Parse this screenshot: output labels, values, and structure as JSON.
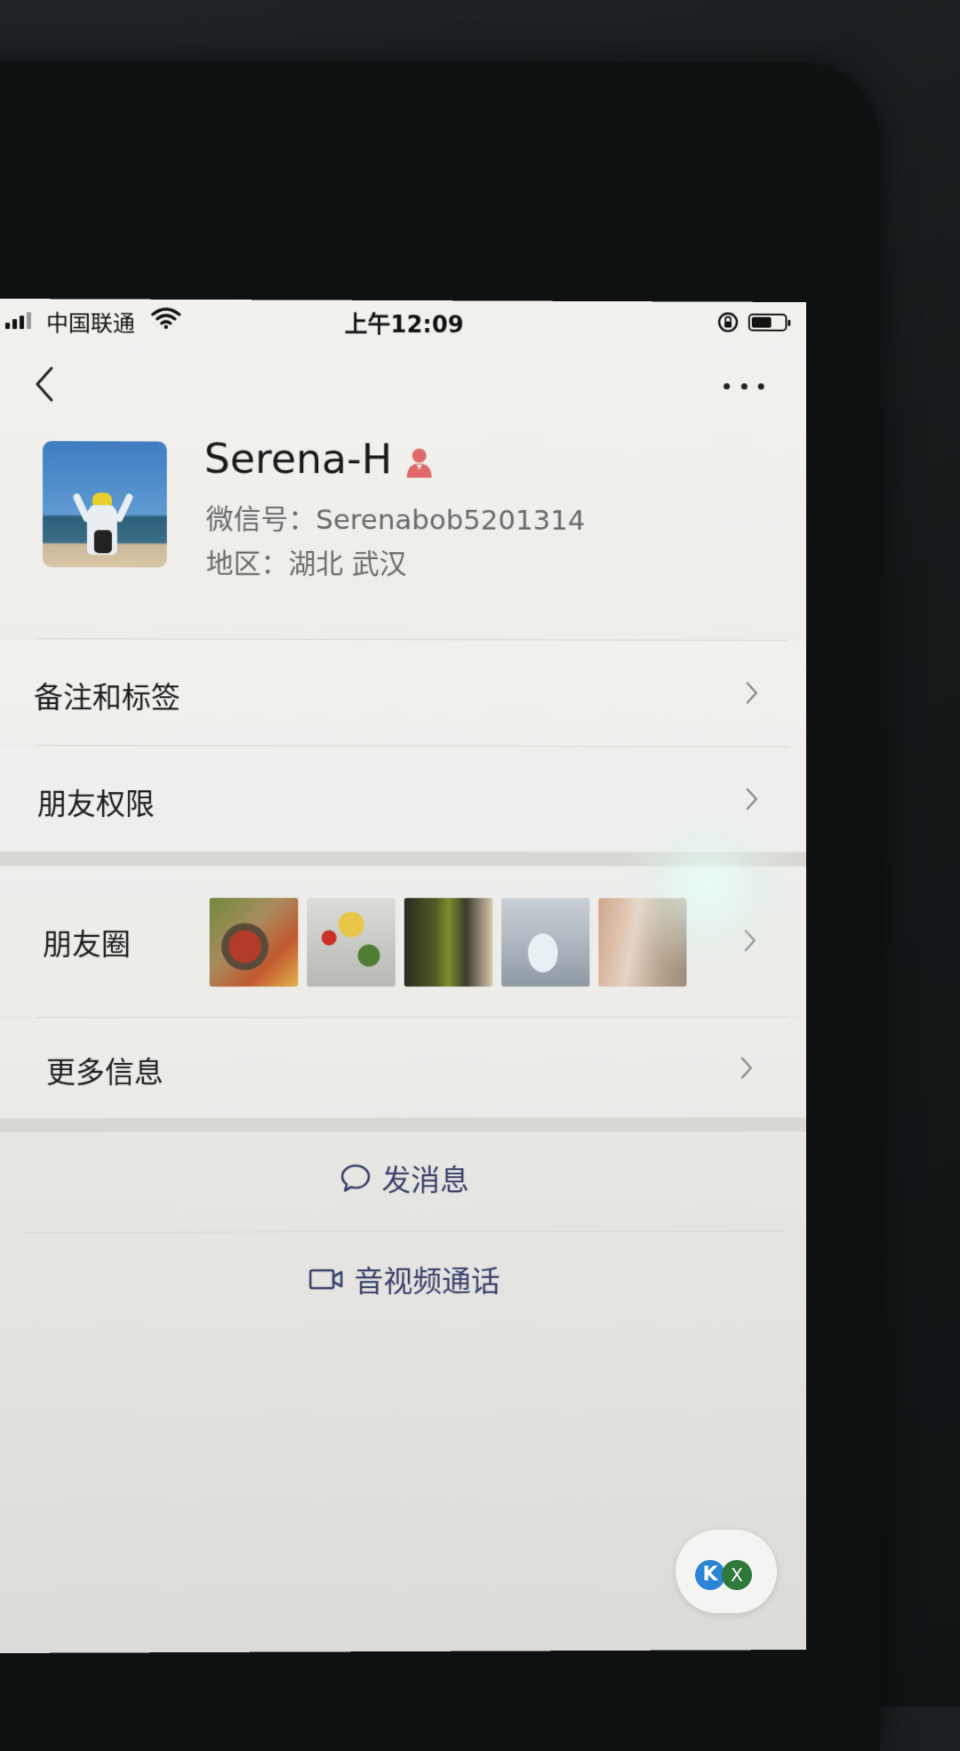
{
  "status_bar": {
    "carrier": "中国联通",
    "time": "上午12:09"
  },
  "profile": {
    "name": "Serena-H",
    "wechat_id": "微信号：Serenabob5201314",
    "region": "地区：湖北 武汉"
  },
  "menu": {
    "remarks_tags": "备注和标签",
    "friend_permissions": "朋友权限",
    "moments": "朋友圈",
    "more_info": "更多信息"
  },
  "actions": {
    "send_message": "发消息",
    "video_call": "音视频通话"
  },
  "floating": {
    "k_label": "K",
    "x_label": "X"
  },
  "colors": {
    "action_text": "#38406b",
    "gender_icon": "#e06a6a",
    "page_bg": "#f2f1ee"
  }
}
